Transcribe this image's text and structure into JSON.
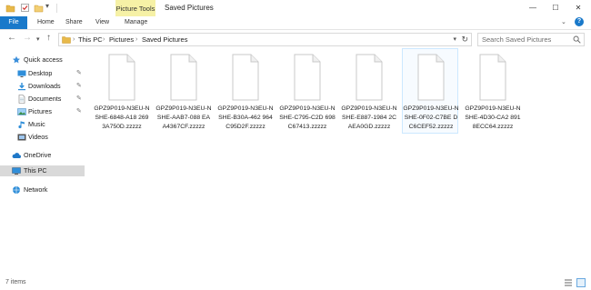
{
  "window": {
    "title": "Saved Pictures",
    "context_tab": "Picture Tools",
    "buttons": {
      "minimize": "—",
      "maximize": "☐",
      "close": "✕"
    }
  },
  "ribbon": {
    "tabs": [
      "File",
      "Home",
      "Share",
      "View",
      "Manage"
    ],
    "toggle_glyph": "⌄",
    "help_glyph": "?"
  },
  "address": {
    "breadcrumbs": [
      "This PC",
      "Pictures",
      "Saved Pictures"
    ],
    "separator": "›"
  },
  "search": {
    "placeholder": "Search Saved Pictures",
    "value": ""
  },
  "sidebar": {
    "items": [
      {
        "label": "Quick access",
        "icon": "star-icon",
        "pinned": false
      },
      {
        "label": "Desktop",
        "icon": "desktop-icon",
        "pinned": true
      },
      {
        "label": "Downloads",
        "icon": "downloads-icon",
        "pinned": true
      },
      {
        "label": "Documents",
        "icon": "documents-icon",
        "pinned": true
      },
      {
        "label": "Pictures",
        "icon": "pictures-icon",
        "pinned": true
      },
      {
        "label": "Music",
        "icon": "music-icon",
        "pinned": false
      },
      {
        "label": "Videos",
        "icon": "videos-icon",
        "pinned": false
      },
      {
        "label": "OneDrive",
        "icon": "cloud-icon",
        "pinned": false
      },
      {
        "label": "This PC",
        "icon": "computer-icon",
        "pinned": false,
        "selected": true
      },
      {
        "label": "Network",
        "icon": "network-icon",
        "pinned": false
      }
    ]
  },
  "files": [
    {
      "name": "GPZ9P019-N3EU-NSHE-6848-A18 2693A750D.zzzzz"
    },
    {
      "name": "GPZ9P019-N3EU-NSHE-AAB7-088 EAA4367CF.zzzzz"
    },
    {
      "name": "GPZ9P019-N3EU-NSHE-B30A-462 964C95D2F.zzzzz"
    },
    {
      "name": "GPZ9P019-N3EU-NSHE-C795-C2D 698C67413.zzzzz"
    },
    {
      "name": "GPZ9P019-N3EU-NSHE-E887-1984 2CAEA0GD.zzzzz"
    },
    {
      "name": "GPZ9P019-N3EU-NSHE-0F02-C7BE DC6CEF52.zzzzz",
      "selected": true
    },
    {
      "name": "GPZ9P019-N3EU-NSHE-4D30-CA2 8918ECC64.zzzzz"
    }
  ],
  "status": {
    "item_count": "7 items"
  },
  "colors": {
    "accent": "#1979ca",
    "context_tab": "#f6f1a6",
    "selection": "#cce8ff"
  }
}
